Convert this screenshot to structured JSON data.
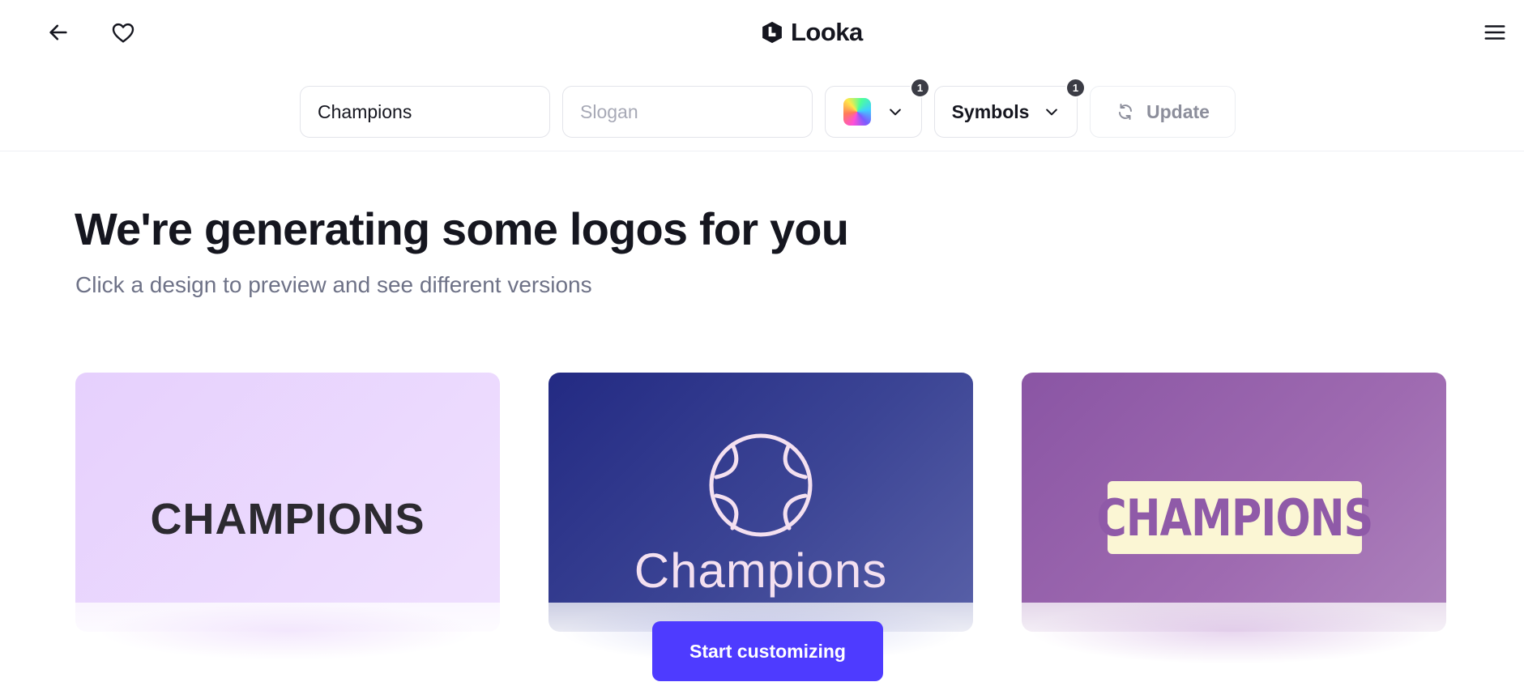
{
  "header": {
    "brand_name": "Looka",
    "icons": {
      "back": "arrow-left-icon",
      "favorite": "heart-outline-icon",
      "logo": "looka-logo-icon",
      "menu": "hamburger-menu-icon"
    }
  },
  "toolbar": {
    "name_value": "Champions",
    "slogan_placeholder": "Slogan",
    "color_badge": "1",
    "symbols_label": "Symbols",
    "symbols_badge": "1",
    "update_label": "Update",
    "icons": {
      "dropdown": "chevron-down-icon",
      "refresh": "refresh-icon"
    }
  },
  "main": {
    "headline": "We're generating some logos for you",
    "subline": "Click a design to preview and see different versions"
  },
  "cards": [
    {
      "wordmark": "CHAMPIONS",
      "background": "#e8d3fd",
      "text_color": "#2c2a30"
    },
    {
      "wordmark": "Champions",
      "background": "#2a3189",
      "text_color": "#f4e0f0",
      "icon": "ball-emblem-icon"
    },
    {
      "wordmark": "CHAMPIONS",
      "background": "#9461ab",
      "text_color": "#8f5aa8",
      "plate_color": "#fbf6d4"
    }
  ],
  "cta": {
    "label": "Start customizing",
    "color": "#4e3bff"
  },
  "colors": {
    "text_primary": "#15161f",
    "text_secondary": "#6e7287",
    "border": "#e3e4ea",
    "badge": "#3b3c45"
  }
}
